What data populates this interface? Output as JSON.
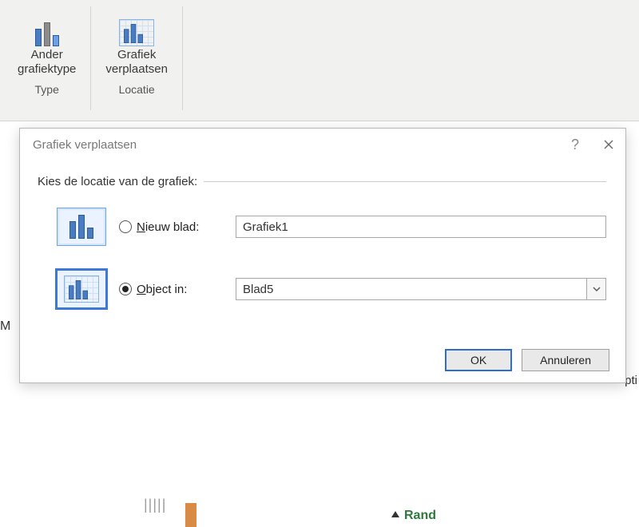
{
  "ribbon": {
    "group1": {
      "btn_label": "Ander\ngrafiektype",
      "name": "Type"
    },
    "group2": {
      "btn_label": "Grafiek\nverplaatsen",
      "name": "Locatie"
    }
  },
  "bg": {
    "left_letter": "M",
    "right_fragment": "pti",
    "dividers": "| | | | |",
    "collapsed_label": "Rand"
  },
  "dialog": {
    "title": "Grafiek verplaatsen",
    "legend": "Kies de locatie van de grafiek:",
    "radio_newsheet_label": "Nieuw blad:",
    "radio_newsheet_underline": "N",
    "newsheet_value": "Grafiek1",
    "radio_objectin_label": "Object in:",
    "radio_objectin_underline": "O",
    "objectin_value": "Blad5",
    "ok": "OK",
    "cancel": "Annuleren",
    "help_char": "?",
    "selected": "objectin"
  }
}
